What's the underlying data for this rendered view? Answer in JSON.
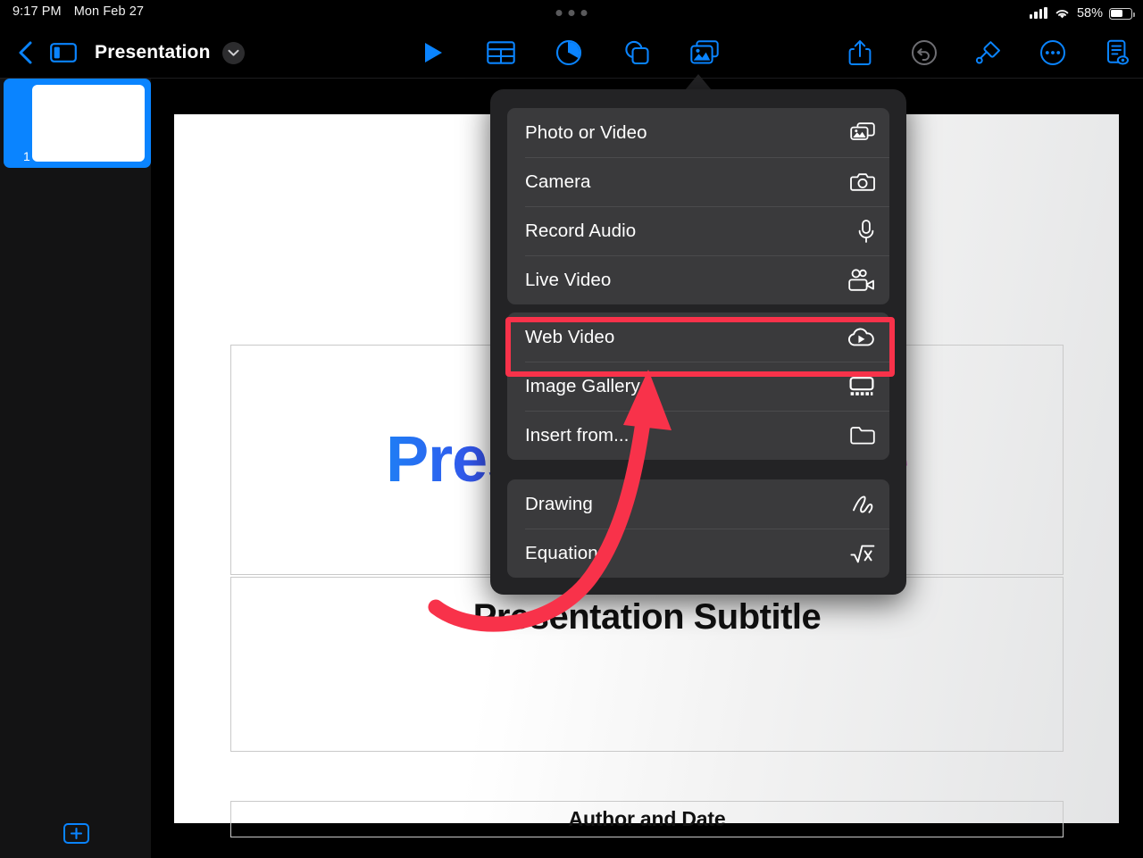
{
  "status_bar": {
    "time": "9:17 PM",
    "date": "Mon Feb 27",
    "battery_percent": "58%",
    "icons": [
      "cellular-signal-icon",
      "wifi-icon",
      "battery-icon"
    ],
    "multitask_handle": "three-dots-handle"
  },
  "toolbar": {
    "back_label": "back-chevron",
    "sidebar_toggle": "sidebar-toggle-icon",
    "document_title": "Presentation",
    "title_menu": "chevron-down-icon",
    "center_buttons": [
      {
        "name": "play-button",
        "icon": "play-icon"
      },
      {
        "name": "table-button",
        "icon": "table-icon"
      },
      {
        "name": "chart-button",
        "icon": "pie-chart-icon"
      },
      {
        "name": "shape-button",
        "icon": "shapes-icon"
      },
      {
        "name": "media-button",
        "icon": "media-image-icon",
        "active": true
      }
    ],
    "right_buttons": [
      {
        "name": "share-button",
        "icon": "share-icon"
      },
      {
        "name": "undo-button",
        "icon": "undo-icon",
        "disabled": true
      },
      {
        "name": "format-button",
        "icon": "paintbrush-icon"
      },
      {
        "name": "more-button",
        "icon": "ellipsis-circle-icon"
      },
      {
        "name": "presenter-notes-button",
        "icon": "document-eye-icon"
      }
    ]
  },
  "sidebar": {
    "slides": [
      {
        "number": "1",
        "selected": true
      }
    ],
    "add_slide_label": "+"
  },
  "slide": {
    "title": "Presentation Title",
    "subtitle": "Presentation Subtitle",
    "author": "Author and Date",
    "title_gradient_start": "#1f7ef5",
    "title_gradient_end": "#d10bbd"
  },
  "insert_menu": {
    "groups": [
      {
        "items": [
          {
            "label": "Photo or Video",
            "icon": "photo-video-icon"
          },
          {
            "label": "Camera",
            "icon": "camera-icon"
          },
          {
            "label": "Record Audio",
            "icon": "microphone-icon"
          },
          {
            "label": "Live Video",
            "icon": "live-video-icon"
          }
        ]
      },
      {
        "items": [
          {
            "label": "Web Video",
            "icon": "cloud-play-icon",
            "highlighted": true
          },
          {
            "label": "Image Gallery",
            "icon": "image-gallery-icon"
          },
          {
            "label": "Insert from...",
            "icon": "folder-icon"
          }
        ]
      },
      {
        "items": [
          {
            "label": "Drawing",
            "icon": "scribble-icon"
          },
          {
            "label": "Equation",
            "icon": "square-root-icon"
          }
        ]
      }
    ]
  },
  "annotation": {
    "highlight_color": "#f8324a",
    "highlight_target": "Web Video",
    "arrow": "curved-arrow-pointing-to-web-video"
  }
}
